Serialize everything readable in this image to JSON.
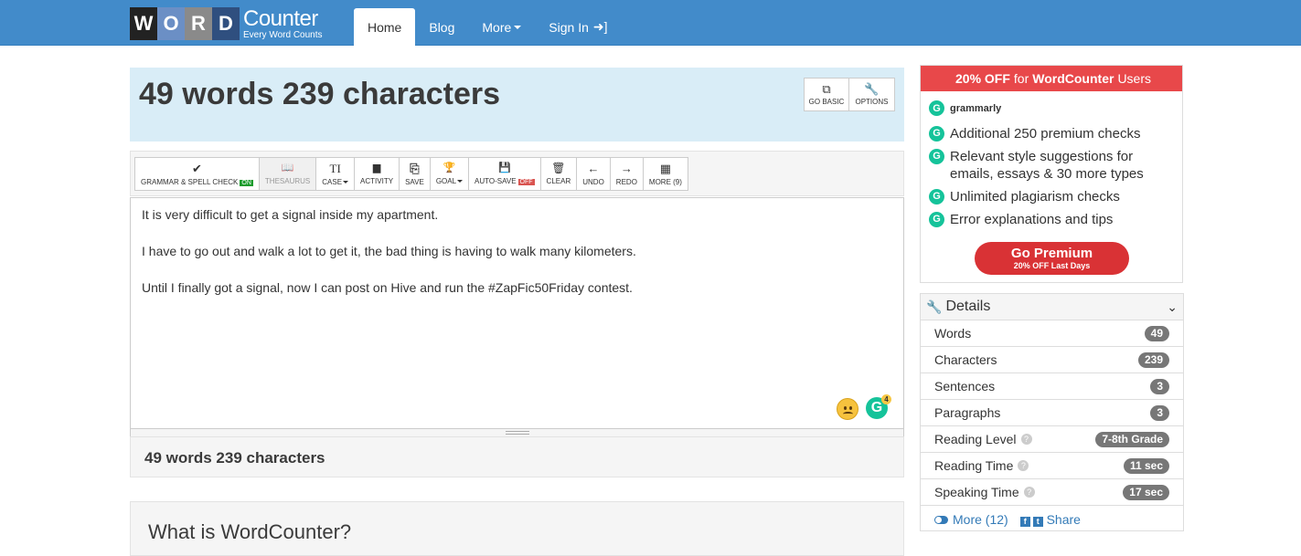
{
  "nav": {
    "logo_letters": [
      "W",
      "O",
      "R",
      "D"
    ],
    "logo_title": "Counter",
    "logo_subtitle": "Every Word Counts",
    "items": [
      {
        "label": "Home",
        "active": true
      },
      {
        "label": "Blog"
      },
      {
        "label": "More"
      },
      {
        "label": "Sign In"
      }
    ]
  },
  "header": {
    "count_title": "49 words 239 characters",
    "buttons": [
      {
        "label": "GO BASIC",
        "icon": "external-link-icon",
        "glyph": "⧉"
      },
      {
        "label": "OPTIONS",
        "icon": "wrench-icon",
        "glyph": "🔧"
      }
    ]
  },
  "toolbar": {
    "grammar": {
      "label": "GRAMMAR & SPELL CHECK",
      "badge": "ON",
      "glyph": "✔"
    },
    "thesaurus": {
      "label": "THESAURUS",
      "glyph": "📖"
    },
    "case": {
      "label": "CASE",
      "glyph": "TI"
    },
    "activity": {
      "label": "ACTIVITY",
      "glyph": "▆"
    },
    "save": {
      "label": "SAVE",
      "glyph": "⎘"
    },
    "goal": {
      "label": "GOAL",
      "glyph": "🏆"
    },
    "autosave": {
      "label": "AUTO-SAVE",
      "badge": "OFF",
      "glyph": "💾"
    },
    "clear": {
      "label": "CLEAR",
      "glyph": "🗑"
    },
    "undo": {
      "label": "UNDO",
      "glyph": "←"
    },
    "redo": {
      "label": "REDO",
      "glyph": "→"
    },
    "more": {
      "label": "MORE (9)",
      "glyph": "▦"
    }
  },
  "editor": {
    "paragraphs": [
      "It is very difficult to get a signal inside my apartment.",
      "I have to go out and walk a lot to get it, the bad thing is having to walk many kilometers.",
      "Until I finally got a signal, now I can post on Hive and run the #ZapFic50Friday contest."
    ],
    "grammarly_count": "4",
    "grammarly_glyph": "G"
  },
  "footer_count": "49 words 239 characters",
  "what_title": "What is WordCounter?",
  "ad": {
    "top_prefix": "20% OFF",
    "top_mid": "for",
    "top_brand": "WordCounter",
    "top_suffix": "Users",
    "brand": "grammarly",
    "g_glyph": "G",
    "features": [
      "Additional 250 premium checks",
      "Relevant style suggestions for emails, essays & 30 more types",
      "Unlimited plagiarism checks",
      "Error explanations and tips"
    ],
    "cta": "Go Premium",
    "cta_sub": "20% OFF Last Days"
  },
  "details": {
    "title": "Details",
    "rows": [
      {
        "label": "Words",
        "value": "49",
        "help": false
      },
      {
        "label": "Characters",
        "value": "239",
        "help": false
      },
      {
        "label": "Sentences",
        "value": "3",
        "help": false
      },
      {
        "label": "Paragraphs",
        "value": "3",
        "help": false
      },
      {
        "label": "Reading Level",
        "value": "7-8th Grade",
        "help": true
      },
      {
        "label": "Reading Time",
        "value": "11 sec",
        "help": true
      },
      {
        "label": "Speaking Time",
        "value": "17 sec",
        "help": true
      }
    ],
    "more_label": "More (12)",
    "share_label": "Share"
  },
  "colors": {
    "navbar": "#428bca",
    "header_bg": "#d9edf7",
    "ad_red": "#e8484a",
    "grammarly_green": "#15c39a"
  }
}
